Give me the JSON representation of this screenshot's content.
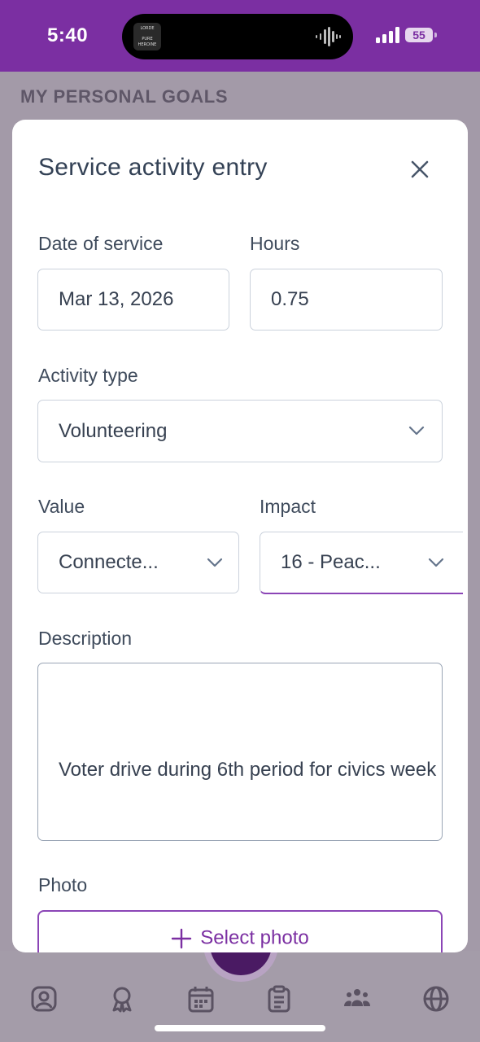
{
  "status_bar": {
    "time": "5:40",
    "album_art": {
      "line1": "LORDE",
      "line2": "PURE",
      "line3": "HEROINE"
    },
    "battery": "55"
  },
  "background": {
    "heading": "MY PERSONAL GOALS"
  },
  "modal": {
    "title": "Service activity entry",
    "date_label": "Date of service",
    "date_value": "Mar 13, 2026",
    "hours_label": "Hours",
    "hours_value": "0.75",
    "activity_label": "Activity type",
    "activity_value": "Volunteering",
    "value_label": "Value",
    "value_value": "Connecte...",
    "impact_label": "Impact",
    "impact_value": "16 - Peac...",
    "description_label": "Description",
    "description_value": "Voter drive during 6th period for civics week",
    "photo_label": "Photo",
    "photo_button": "Select photo"
  },
  "tabbar": {
    "icons": [
      "profile-icon",
      "award-icon",
      "calendar-icon",
      "clipboard-icon",
      "people-icon",
      "globe-icon"
    ]
  },
  "colors": {
    "brand_purple": "#7b2fa2",
    "overlay": "#a39aa8",
    "text": "#374151"
  }
}
